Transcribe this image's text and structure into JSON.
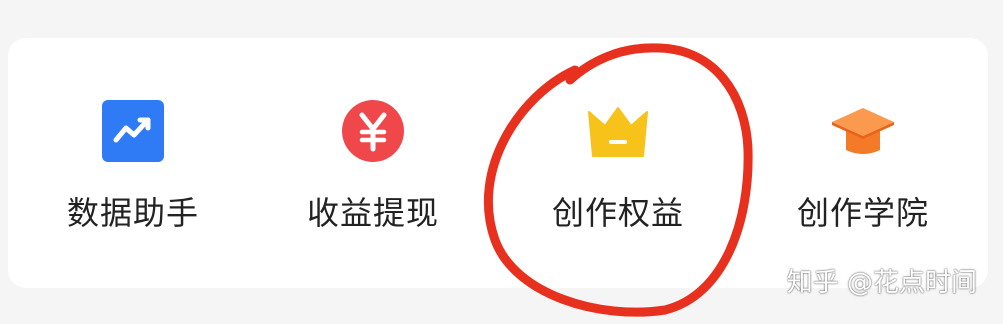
{
  "tools": [
    {
      "label": "数据助手",
      "icon": "trend-chart-icon",
      "color": "#2f7bf5"
    },
    {
      "label": "收益提现",
      "icon": "yuan-coin-icon",
      "color": "#f0484a"
    },
    {
      "label": "创作权益",
      "icon": "crown-icon",
      "color": "#f7c21a"
    },
    {
      "label": "创作学院",
      "icon": "graduation-cap-icon",
      "color": "#f57a28"
    }
  ],
  "watermark": "知乎 @花点时间",
  "annotation_color": "#e8301e"
}
